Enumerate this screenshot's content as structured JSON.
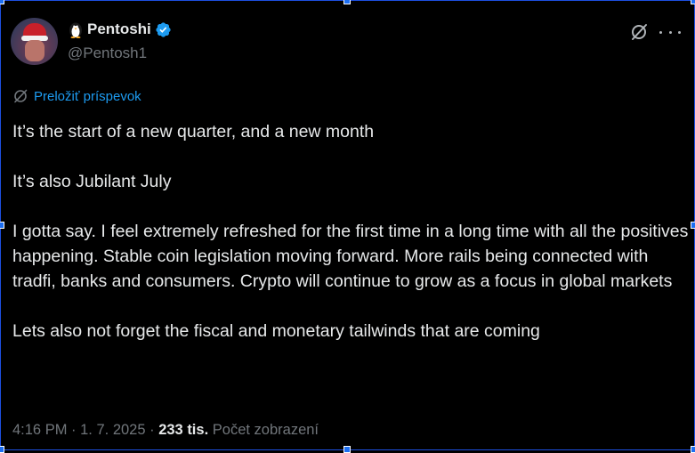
{
  "author": {
    "name": "Pentoshi",
    "handle": "@Pentosh1"
  },
  "translate_label": "Preložiť príspevok",
  "post": {
    "paragraphs": [
      "It’s the start of a new quarter, and a new month",
      "It’s also Jubilant July",
      "I gotta say. I feel extremely refreshed for the first time in a long time with all the positives happening. Stable coin legislation moving forward. More rails being connected with tradfi, banks and consumers. Crypto will continue to grow as a focus in global markets",
      "Lets also not forget the fiscal and monetary tailwinds that are coming"
    ]
  },
  "meta": {
    "time": "4:16 PM",
    "sep1": " · ",
    "date": "1. 7. 2025",
    "sep2": " · ",
    "views_count": "233 tis.",
    "views_label": "Počet zobrazení"
  },
  "icons": {
    "verified": "verified-badge-icon",
    "penguin": "penguin-emoji-icon",
    "grok": "grok-icon",
    "more": "more-icon",
    "translate": "translate-icon"
  },
  "colors": {
    "background": "#000000",
    "text": "#e7e9ea",
    "muted": "#71767b",
    "accent": "#1d9bf0",
    "selection": "#1d4fe0"
  }
}
